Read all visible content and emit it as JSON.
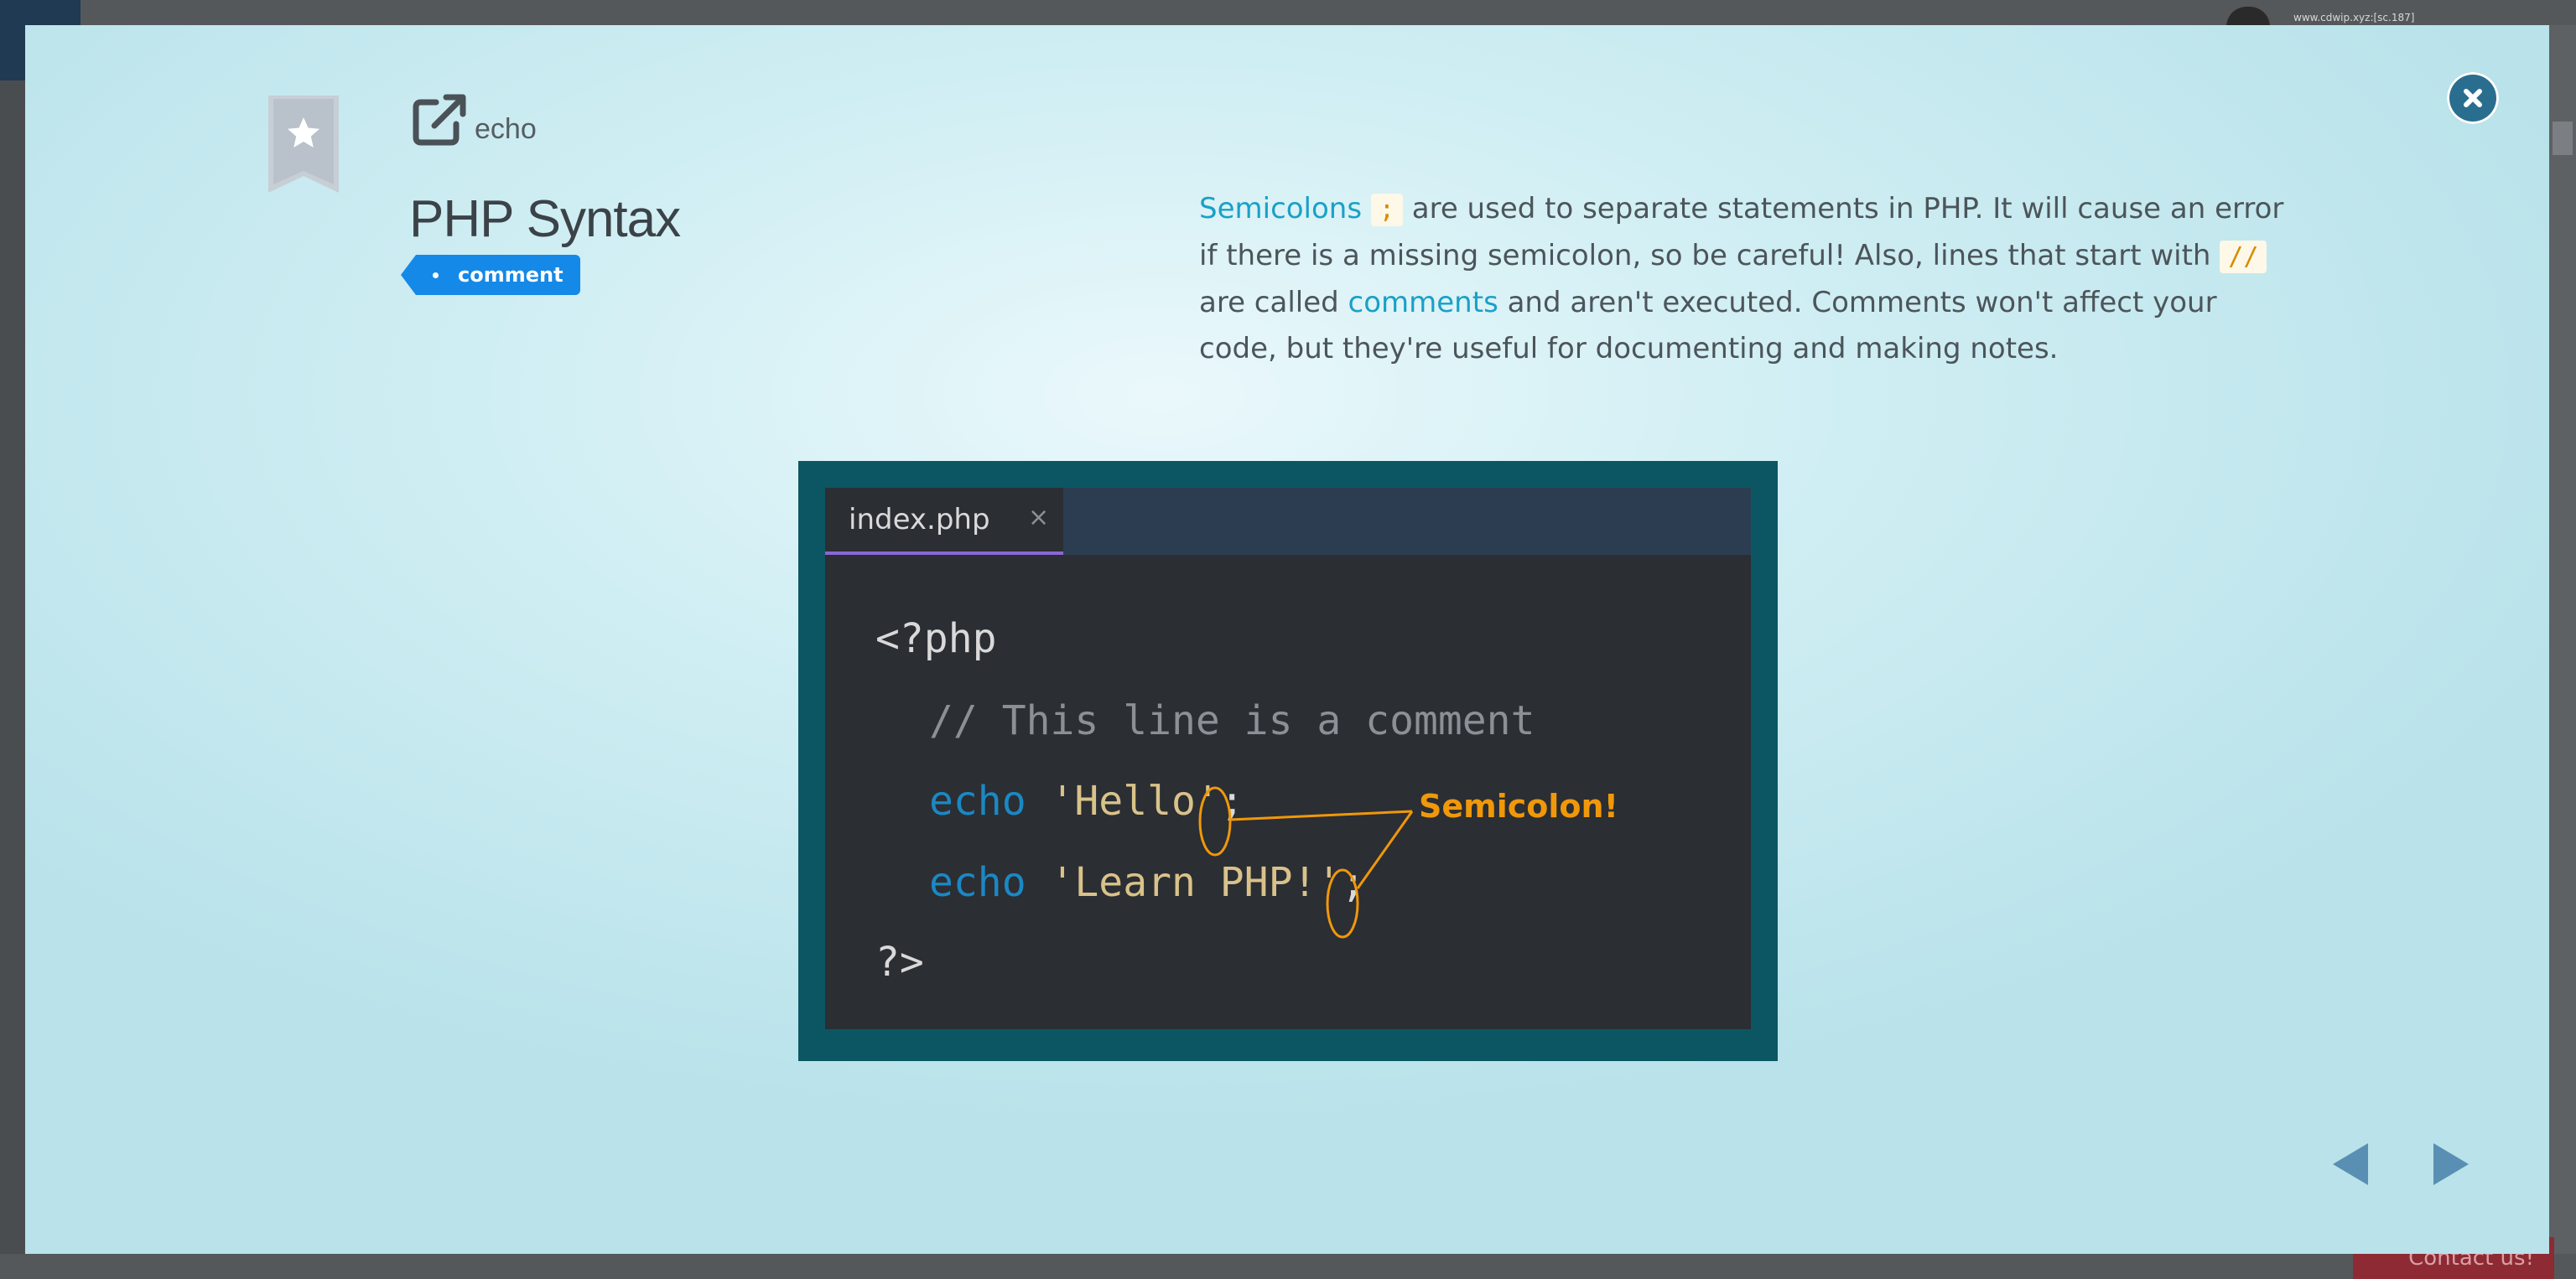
{
  "background": {
    "url_text": "www.cdwip.xyz:[sc.187]",
    "contact_label": "Contact us!"
  },
  "modal": {
    "close_icon": "close-icon",
    "bookmark_icon": "bookmark-star-icon",
    "external_link_icon": "external-link-icon",
    "category_label": "echo",
    "title": "PHP Syntax",
    "tag_label": "comment",
    "description": {
      "link1": "Semicolons",
      "code1": ";",
      "text1": " are used to separate statements in PHP. It will cause an error if there is a missing semicolon, so be careful! Also, lines that start with ",
      "code2": "//",
      "text2": " are called ",
      "link2": "comments",
      "text3": " and aren't executed. Comments won't affect your code, but they're useful for documenting and making notes."
    },
    "code_image": {
      "file_tab": "index.php",
      "tab_close": "×",
      "line1": "<?php",
      "line2": "// This line is a comment",
      "line3_kw": "echo",
      "line3_str": " 'Hello'",
      "line3_semi": ";",
      "line4_kw": "echo",
      "line4_str": " 'Learn PHP!'",
      "line4_semi": ";",
      "line5": "?>",
      "callout": "Semicolon!"
    },
    "nav": {
      "prev_icon": "triangle-left-icon",
      "next_icon": "triangle-right-icon"
    }
  },
  "colors": {
    "accent_link": "#1aa0c8",
    "tag_blue": "#1589e8",
    "close_button": "#2a6e8f",
    "code_frame": "#0c5663",
    "callout_orange": "#f0980a"
  }
}
